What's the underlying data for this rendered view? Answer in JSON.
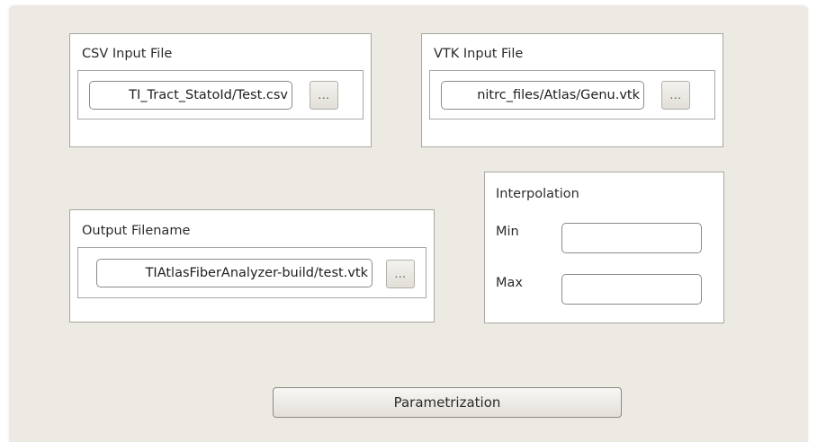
{
  "csv_group": {
    "title": "CSV Input File",
    "path_value": "TI_Tract_StatoId/Test.csv",
    "browse_label": "..."
  },
  "vtk_group": {
    "title": "VTK Input File",
    "path_value": "nitrc_files/Atlas/Genu.vtk",
    "browse_label": "..."
  },
  "output_group": {
    "title": "Output Filename",
    "path_value": "TIAtlasFiberAnalyzer-build/test.vtk",
    "browse_label": "..."
  },
  "interpolation_group": {
    "title": "Interpolation",
    "min_label": "Min",
    "min_value": "",
    "max_label": "Max",
    "max_value": ""
  },
  "actions": {
    "parametrization_label": "Parametrization"
  }
}
